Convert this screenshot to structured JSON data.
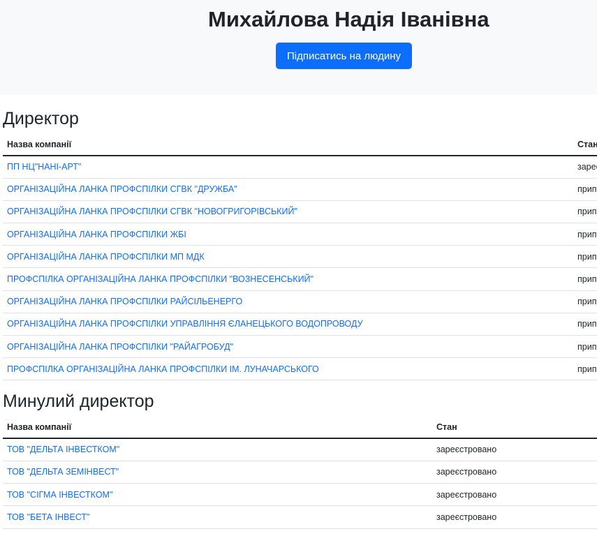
{
  "header": {
    "person_name": "Михайлова Надія Іванівна",
    "subscribe_label": "Підписатись на людину"
  },
  "directors": {
    "title": "Директор",
    "columns": [
      "Назва компанії",
      "Стан"
    ],
    "rows": [
      {
        "company": "ПП НЦ\"НАНІ-АРТ\"",
        "status": "зареєстровано"
      },
      {
        "company": "ОРГАНІЗАЦІЙНА ЛАНКА ПРОФСПІЛКИ СГВК \"ДРУЖБА\"",
        "status": "припинено"
      },
      {
        "company": "ОРГАНІЗАЦІЙНА ЛАНКА ПРОФСПІЛКИ СГВК \"НОВОГРИГОРІВСЬКИЙ\"",
        "status": "припинено"
      },
      {
        "company": "ОРГАНІЗАЦІЙНА ЛАНКА ПРОФСПІЛКИ ЖБІ",
        "status": "припинено"
      },
      {
        "company": "ОРГАНІЗАЦІЙНА ЛАНКА ПРОФСПІЛКИ МП МДК",
        "status": "припинено"
      },
      {
        "company": "ПРОФСПІЛКА ОРГАНІЗАЦІЙНА ЛАНКА ПРОФСПІЛКИ \"ВОЗНЕСЕНСЬКИЙ\"",
        "status": "припинено"
      },
      {
        "company": "ОРГАНІЗАЦІЙНА ЛАНКА ПРОФСПІЛКИ РАЙСІЛЬЕНЕРГО",
        "status": "припинено"
      },
      {
        "company": "ОРГАНІЗАЦІЙНА ЛАНКА ПРОФСПІЛКИ УПРАВЛІННЯ ЄЛАНЕЦЬКОГО ВОДОПРОВОДУ",
        "status": "припинено"
      },
      {
        "company": "ОРГАНІЗАЦІЙНА ЛАНКА ПРОФСПІЛКИ \"РАЙАГРОБУД\"",
        "status": "припинено"
      },
      {
        "company": "ПРОФСПІЛКА ОРГАНІЗАЦІЙНА ЛАНКА ПРОФСПІЛКИ ІМ. ЛУНАЧАРСЬКОГО",
        "status": "припинено"
      }
    ]
  },
  "past_directors": {
    "title": "Минулий директор",
    "columns": [
      "Назва компанії",
      "Стан"
    ],
    "rows": [
      {
        "company": "ТОВ \"ДЕЛЬТА ІНВЕСТКОМ\"",
        "status": "зареєстровано"
      },
      {
        "company": "ТОВ \"ДЕЛЬТА ЗЕМІНВЕСТ\"",
        "status": "зареєстровано"
      },
      {
        "company": "ТОВ \"СІГМА ІНВЕСТКОМ\"",
        "status": "зареєстровано"
      },
      {
        "company": "ТОВ \"БЕТА ІНВЕСТ\"",
        "status": "зареєстровано"
      }
    ]
  },
  "colors": {
    "link": "#0d6efd",
    "button_bg": "#0d6efd",
    "hero_bg": "#f8f9fa",
    "text": "#212529"
  }
}
